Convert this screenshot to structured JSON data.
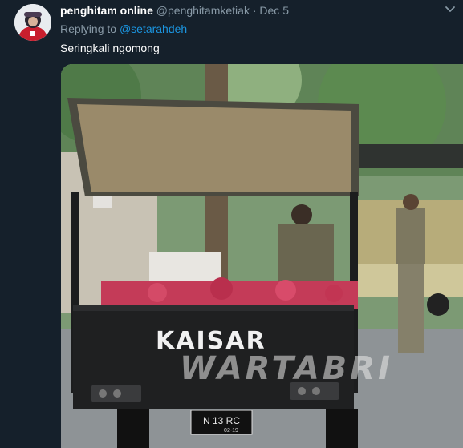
{
  "tweet": {
    "display_name": "penghitam online",
    "handle": "@penghitamketiak",
    "separator": "·",
    "date": "Dec 5",
    "replying_label": "Replying to",
    "replying_to": "@setarahdeh",
    "text": "Seringkali ngomong"
  },
  "media": {
    "vehicle_label": "KAISAR",
    "watermark": "WARTABRI",
    "plate": "N 13 RC",
    "plate_sub": "02-19"
  },
  "colors": {
    "background": "#15202b",
    "primary_text": "#ffffff",
    "secondary_text": "#8899a6",
    "link": "#1b95e0"
  },
  "icons": {
    "menu": "chevron-down-icon"
  }
}
